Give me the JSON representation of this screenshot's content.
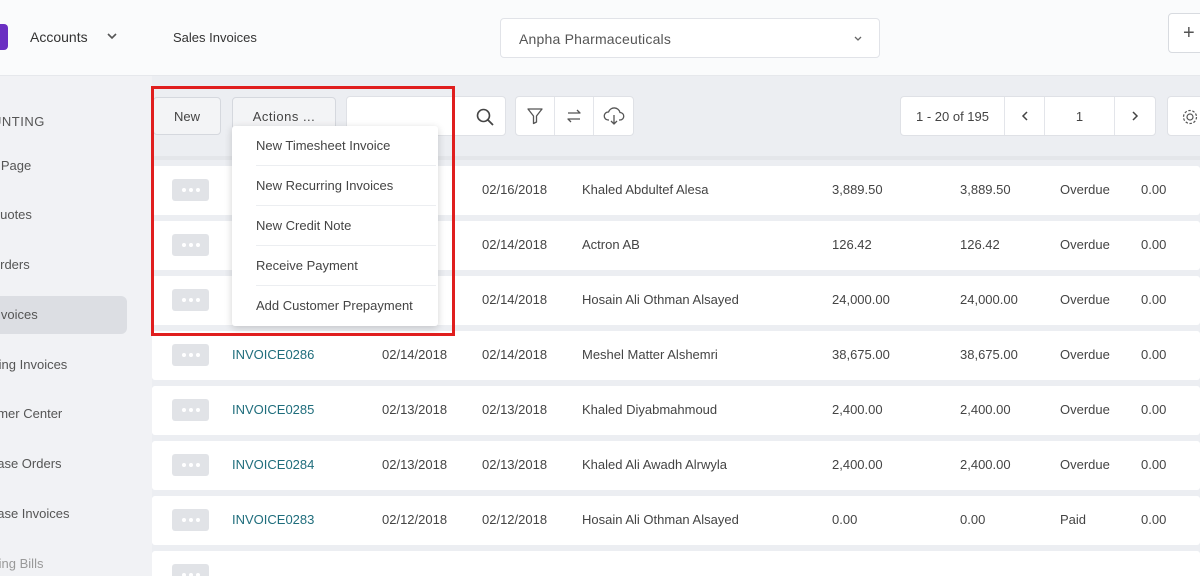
{
  "sidebar": {
    "app_name": "Accounts",
    "section_heading": "UNTING",
    "items": [
      {
        "label": "e Page"
      },
      {
        "label": " Quotes"
      },
      {
        "label": " Orders"
      },
      {
        "label": " Invoices"
      },
      {
        "label": "rring Invoices"
      },
      {
        "label": "omer Center"
      },
      {
        "label": "hase Orders"
      },
      {
        "label": "hase Invoices"
      },
      {
        "label": "rring Bills"
      }
    ],
    "active_index": 3
  },
  "header": {
    "title": "Sales Invoices",
    "company": "Anpha Pharmaceuticals",
    "plus_label": "+"
  },
  "toolbar": {
    "new_label": "New",
    "actions_label": "Actions ...",
    "search_value": "",
    "pager_range": "1 - 20 of 195",
    "page_number": "1"
  },
  "actions_menu": {
    "items": [
      "New Timesheet Invoice",
      "New Recurring Invoices",
      "New Credit Note",
      "Receive Payment",
      "Add Customer Prepayment"
    ]
  },
  "invoices": [
    {
      "number": "",
      "date": "",
      "due_date": "02/16/2018",
      "customer": "Khaled Abdultef Alesa",
      "amount": "3,889.50",
      "balance": "3,889.50",
      "status": "Overdue",
      "paid": "0.00"
    },
    {
      "number": "",
      "date": "",
      "due_date": "02/14/2018",
      "customer": "Actron AB",
      "amount": "126.42",
      "balance": "126.42",
      "status": "Overdue",
      "paid": "0.00"
    },
    {
      "number": "",
      "date": "",
      "due_date": "02/14/2018",
      "customer": "Hosain Ali Othman Alsayed",
      "amount": "24,000.00",
      "balance": "24,000.00",
      "status": "Overdue",
      "paid": "0.00"
    },
    {
      "number": "INVOICE0286",
      "date": "02/14/2018",
      "due_date": "02/14/2018",
      "customer": "Meshel Matter Alshemri",
      "amount": "38,675.00",
      "balance": "38,675.00",
      "status": "Overdue",
      "paid": "0.00"
    },
    {
      "number": "INVOICE0285",
      "date": "02/13/2018",
      "due_date": "02/13/2018",
      "customer": "Khaled Diyabmahmoud",
      "amount": "2,400.00",
      "balance": "2,400.00",
      "status": "Overdue",
      "paid": "0.00"
    },
    {
      "number": "INVOICE0284",
      "date": "02/13/2018",
      "due_date": "02/13/2018",
      "customer": "Khaled Ali Awadh Alrwyla",
      "amount": "2,400.00",
      "balance": "2,400.00",
      "status": "Overdue",
      "paid": "0.00"
    },
    {
      "number": "INVOICE0283",
      "date": "02/12/2018",
      "due_date": "02/12/2018",
      "customer": "Hosain Ali Othman Alsayed",
      "amount": "0.00",
      "balance": "0.00",
      "status": "Paid",
      "paid": "0.00"
    }
  ],
  "colors": {
    "brand": "#6a2fc2",
    "link": "#1f6d7c",
    "highlight": "#e01e1e"
  }
}
